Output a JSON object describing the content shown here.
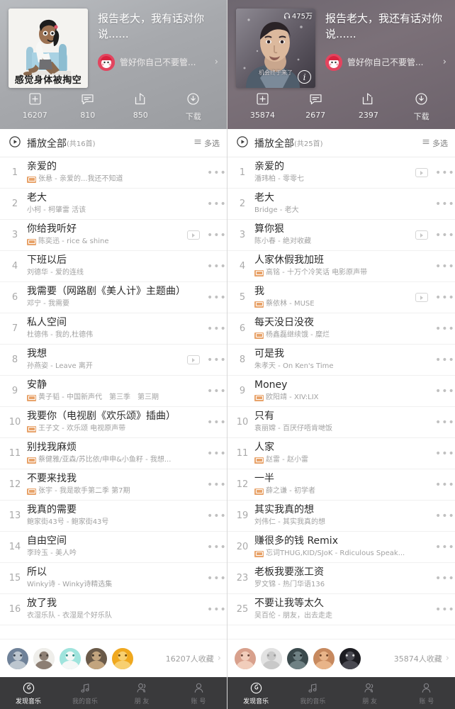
{
  "screens": [
    {
      "header": {
        "title": "报告老大，我有话对你说......",
        "cover_caption": "感觉身体被掏空",
        "cover_type": "cartoon",
        "play_count": "",
        "creator": "管好你自己不要管...",
        "chevron": "›",
        "actions": [
          {
            "icon": "add-to-collection-icon",
            "label": "16207"
          },
          {
            "icon": "comment-icon",
            "label": "810"
          },
          {
            "icon": "share-icon",
            "label": "850"
          },
          {
            "icon": "download-icon",
            "label": "下载"
          }
        ]
      },
      "playall": {
        "label": "播放全部",
        "count": "(共16首)",
        "multi_label": "多选"
      },
      "songs": [
        {
          "num": "1",
          "title": "亲爱的",
          "sq": true,
          "artist": "张悬 - 亲爱的...我还不知道",
          "mv": false
        },
        {
          "num": "2",
          "title": "老大",
          "sq": false,
          "artist": "小柯 - 柯肇雷 活该",
          "mv": false
        },
        {
          "num": "3",
          "title": "你给我听好",
          "sq": true,
          "artist": "陈奕迅 - rice & shine",
          "mv": true
        },
        {
          "num": "4",
          "title": "下班以后",
          "sq": false,
          "artist": "刘德华 - 爱的连线",
          "mv": false
        },
        {
          "num": "6",
          "title": "我需要",
          "suffix": "（网路剧《美人计》主题曲）",
          "sq": false,
          "artist": "邓宁 - 我需要",
          "mv": false
        },
        {
          "num": "7",
          "title": "私人空间",
          "sq": false,
          "artist": "杜德伟 - 我的,杜德伟",
          "mv": false
        },
        {
          "num": "8",
          "title": "我想",
          "sq": false,
          "artist": "孙燕姿 - Leave 离开",
          "mv": true
        },
        {
          "num": "9",
          "title": "安静",
          "sq": true,
          "artist": "黄子韬 - 中国新声代　第三季　第三期",
          "mv": false
        },
        {
          "num": "10",
          "title": "我要你",
          "suffix": "（电视剧《欢乐颂》插曲）",
          "sq": true,
          "artist": "王子文 - 欢乐颂 电视原声带",
          "mv": false
        },
        {
          "num": "11",
          "title": "别找我麻烦",
          "sq": true,
          "artist": "蔡健雅/亚森/苏比依/申申&小鱼籽 - 我想...",
          "mv": false
        },
        {
          "num": "12",
          "title": "不要来找我",
          "sq": true,
          "artist": "张宇 - 我是歌手第二季 第7期",
          "mv": false
        },
        {
          "num": "13",
          "title": "我真的需要",
          "sq": false,
          "artist": "鲍家街43号 - 鲍家街43号",
          "mv": false
        },
        {
          "num": "14",
          "title": "自由空间",
          "sq": false,
          "artist": "李玲玉 - 美人吟",
          "mv": false
        },
        {
          "num": "15",
          "title": "所以",
          "sq": false,
          "artist": "Winky诗 - Winky诗精选集",
          "mv": false
        },
        {
          "num": "16",
          "title": "放了我",
          "sq": false,
          "artist": "衣湿乐队 - 衣湿是个好乐队",
          "mv": false
        }
      ],
      "collectors": {
        "count_label": "16207人收藏",
        "chevron": "›",
        "avatar_count": 5
      },
      "tabs": [
        {
          "icon": "netease-logo-icon",
          "label": "发现音乐",
          "active": true
        },
        {
          "icon": "music-note-icon",
          "label": "我的音乐",
          "active": false
        },
        {
          "icon": "friends-icon",
          "label": "朋 友",
          "active": false
        },
        {
          "icon": "account-icon",
          "label": "账 号",
          "active": false
        }
      ]
    },
    {
      "header": {
        "title": "报告老大，我还有话对你说......",
        "cover_caption": "",
        "cover_subcaption": "机会终于来了",
        "cover_type": "photo",
        "play_count": "475万",
        "info_badge": "i",
        "creator": "管好你自己不要管...",
        "chevron": "›",
        "actions": [
          {
            "icon": "add-to-collection-icon",
            "label": "35874"
          },
          {
            "icon": "comment-icon",
            "label": "2677"
          },
          {
            "icon": "share-icon",
            "label": "2397"
          },
          {
            "icon": "download-icon",
            "label": "下载"
          }
        ]
      },
      "playall": {
        "label": "播放全部",
        "count": "(共25首)",
        "multi_label": "多选"
      },
      "songs": [
        {
          "num": "1",
          "title": "亲爱的",
          "sq": false,
          "artist": "潘玮柏 - 零零七",
          "mv": true
        },
        {
          "num": "2",
          "title": "老大",
          "sq": false,
          "artist": "Bridge - 老大",
          "mv": false
        },
        {
          "num": "3",
          "title": "算你狠",
          "sq": false,
          "artist": "陈小春 - 绝对收藏",
          "mv": true
        },
        {
          "num": "4",
          "title": "人家休假我加班",
          "sq": true,
          "artist": "高铭 - 十万个冷笑话 电影原声带",
          "mv": false
        },
        {
          "num": "5",
          "title": "我",
          "sq": true,
          "artist": "蔡依林 - MUSE",
          "mv": true
        },
        {
          "num": "6",
          "title": "每天没日没夜",
          "sq": true,
          "artist": "杨鑫磊继续饿 - 糜烂",
          "mv": false
        },
        {
          "num": "8",
          "title": "可是我",
          "sq": false,
          "artist": "朱孝天 - On Ken's Time",
          "mv": false
        },
        {
          "num": "9",
          "title": "Money",
          "sq": true,
          "artist": "欧阳靖 - XIV:LIX",
          "mv": false
        },
        {
          "num": "10",
          "title": "只有",
          "sq": false,
          "artist": "袁丽嫦 - 百厌仔唔肯哋饭",
          "mv": false
        },
        {
          "num": "11",
          "title": "人家",
          "sq": true,
          "artist": "赵雷 - 赵小雷",
          "mv": false
        },
        {
          "num": "12",
          "title": "一半",
          "sq": true,
          "artist": "薛之谦 - 初学者",
          "mv": false
        },
        {
          "num": "19",
          "title": "其实我真的想",
          "sq": false,
          "artist": "刘伟仁 - 其实我真的想",
          "mv": false
        },
        {
          "num": "20",
          "title": "赚很多的钱 Remix",
          "sq": true,
          "artist": "忘词THUG,KID/SJoK - Rdiculous Speak...",
          "mv": false
        },
        {
          "num": "23",
          "title": "老板我要涨工资",
          "sq": false,
          "artist": "罗文锦 -  热门华语136",
          "mv": false
        },
        {
          "num": "25",
          "title": "不要让我等太久",
          "sq": false,
          "artist": "吴百伦 - 朋友，出去走走",
          "mv": false
        }
      ],
      "collectors": {
        "count_label": "35874人收藏",
        "chevron": "›",
        "avatar_count": 5
      },
      "tabs": [
        {
          "icon": "netease-logo-icon",
          "label": "发现音乐",
          "active": true
        },
        {
          "icon": "music-note-icon",
          "label": "我的音乐",
          "active": false
        },
        {
          "icon": "friends-icon",
          "label": "朋 友",
          "active": false
        },
        {
          "icon": "account-icon",
          "label": "账 号",
          "active": false
        }
      ]
    }
  ]
}
